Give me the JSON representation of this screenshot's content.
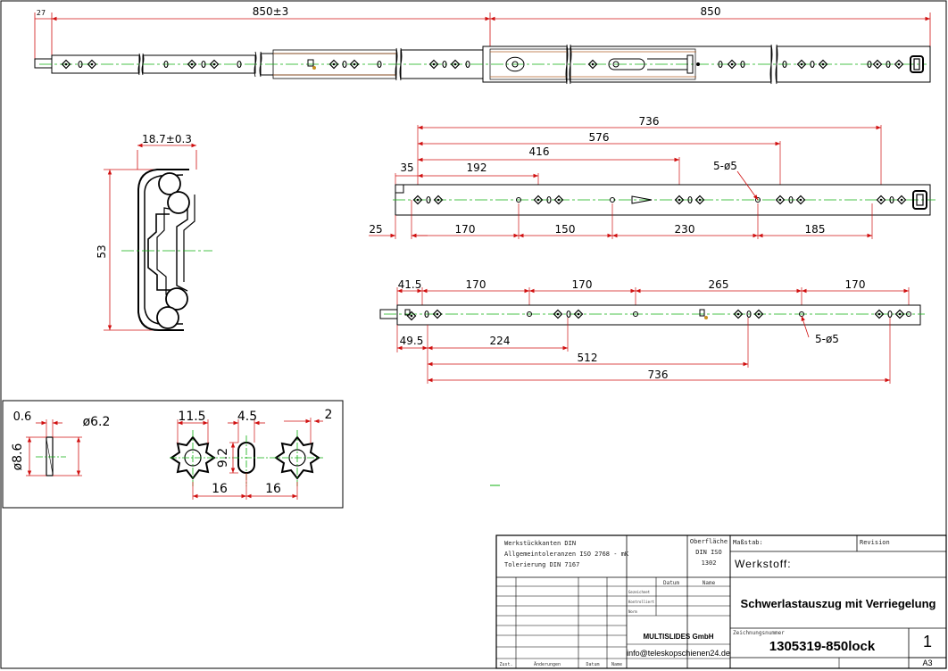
{
  "drawing": {
    "top_dims": {
      "stub": "27",
      "left": "850±3",
      "right": "850"
    },
    "profile": {
      "width": "18.7±0.3",
      "height": "53"
    },
    "rail_a": {
      "top": [
        "736",
        "576",
        "416",
        "192",
        "35"
      ],
      "hole_callout": "5-ø5",
      "bottom": [
        "25",
        "170",
        "150",
        "230",
        "185"
      ]
    },
    "rail_b": {
      "top": [
        "41.5",
        "170",
        "170",
        "265",
        "170"
      ],
      "hole_callout": "5-ø5",
      "bottom": [
        "49.5",
        "224",
        "512",
        "736"
      ]
    },
    "detail": {
      "thickness": "0.6",
      "washer_dia": "ø6.2",
      "washer_outer": "ø8.6",
      "hole_a": "11.5",
      "slot_w": "4.5",
      "slot_h": "9.2",
      "hole_c": "2",
      "pitch1": "16",
      "pitch2": "16"
    }
  },
  "title_block": {
    "notes": [
      "Werkstückkanten DIN",
      "Allgemeintoleranzen ISO 2768 - mK",
      "Tolerierung DIN 7167"
    ],
    "surface_label": "Oberfläche",
    "surface_lines": [
      "DIN ISO",
      "1302"
    ],
    "scale_label": "Maßstab:",
    "revision_label": "Revision",
    "material_label": "Werkstoff:",
    "datum": "Datum",
    "name": "Name",
    "rows": [
      "Gezeichnet",
      "Kontrolliert",
      "Norm"
    ],
    "title": "Schwerlastauszug mit Verriegelung",
    "company": "MULTISLIDES GmbH",
    "email": "info@teleskopschienen24.de",
    "drawing_no_label": "Zeichnungsnummer",
    "drawing_no": "1305319-850lock",
    "sheet": "1",
    "format": "A3",
    "footer": [
      "Zust.",
      "Änderungen",
      "Datum",
      "Name"
    ]
  }
}
